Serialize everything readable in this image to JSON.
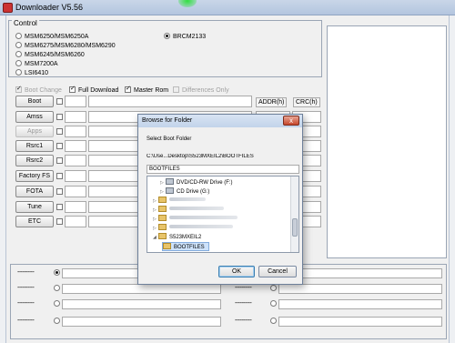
{
  "window": {
    "title": "Downloader V5.56",
    "accent": "#c9d6e8"
  },
  "control": {
    "legend": "Control",
    "options_left": [
      "MSM6250/MSM6250A",
      "MSM6275/MSM6280/MSM6290",
      "MSM6245/MSM6260",
      "MSM7200A",
      "LSI6410"
    ],
    "options_right": [
      "BRCM2133"
    ],
    "selected": "BRCM2133"
  },
  "options": {
    "boot_change": "Boot Change",
    "full_download": "Full Download",
    "master_rom": "Master Rom",
    "differences_only": "Differences Only"
  },
  "columns": {
    "addr": "ADDR(h)",
    "crc": "CRC(h)"
  },
  "buttons": [
    "Boot",
    "Amss",
    "Apps",
    "Rsrc1",
    "Rsrc2",
    "Factory FS",
    "FOTA",
    "Tune",
    "ETC"
  ],
  "bottom": {
    "slot_label": "----------"
  },
  "dialog": {
    "title": "Browse for Folder",
    "close_label": "x",
    "prompt": "Select Boot Folder",
    "path": "C:\\Use...Desktop\\S523MXEIL2\\BOOTFILES",
    "selected_value": "BOOTFILES",
    "tree": {
      "dvd": "DVD/CD-RW Drive (F:)",
      "cd": "CD Drive (G:)",
      "parent": "S523MXEIL2",
      "child": "BOOTFILES"
    },
    "ok": "OK",
    "cancel": "Cancel"
  }
}
